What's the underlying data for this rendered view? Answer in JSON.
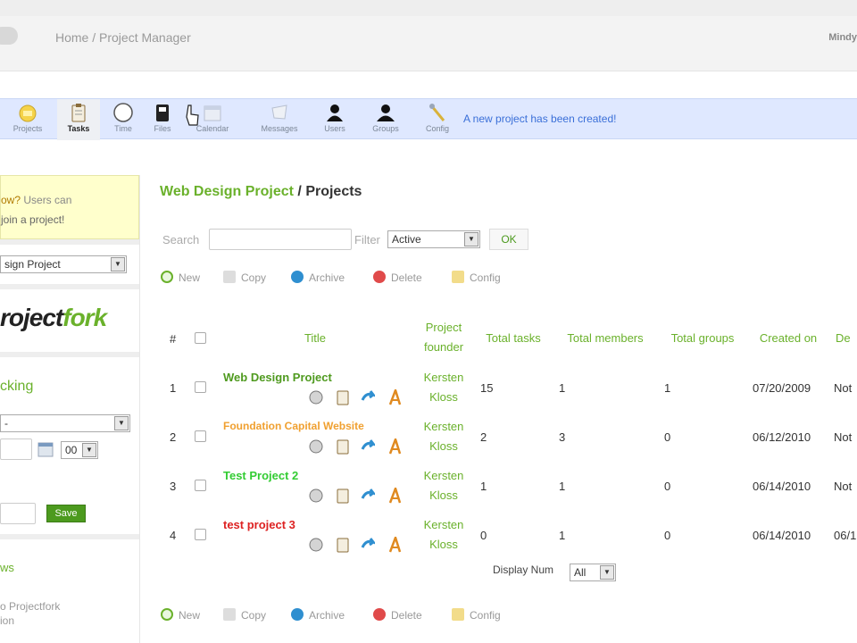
{
  "header": {
    "breadcrumb": "Home / Project Manager",
    "user": "Mindy"
  },
  "toolbar": {
    "items": [
      {
        "label": "Projects",
        "icon": "projects-icon"
      },
      {
        "label": "Tasks",
        "icon": "clipboard-icon"
      },
      {
        "label": "Time",
        "icon": "clock-icon"
      },
      {
        "label": "Files",
        "icon": "file-icon"
      },
      {
        "label": "Calendar",
        "icon": "calendar-icon"
      },
      {
        "label": "Messages",
        "icon": "messages-icon"
      },
      {
        "label": "Users",
        "icon": "user-icon"
      },
      {
        "label": "Groups",
        "icon": "group-icon"
      },
      {
        "label": "Config",
        "icon": "wrench-icon"
      }
    ],
    "status_message": "A new project has been created!"
  },
  "sidebar": {
    "notice_q": "ow?",
    "notice_rest": " Users can",
    "notice_line2": "join a project!",
    "project_select": "sign Project",
    "logo_part1": "roject",
    "logo_part2": "fork",
    "tracking": "cking",
    "tracking_select": "-",
    "minutes_value": "00",
    "save_label": "Save",
    "news_heading": "ws",
    "news_item1": "o Projectfork",
    "news_item2": "ion"
  },
  "main": {
    "project_link": "Web Design Project",
    "separator": " / ",
    "page": "Projects",
    "search_label": "Search",
    "filter_label": "Filter",
    "filter_value": "Active",
    "ok_label": "OK",
    "actions": [
      "New",
      "Copy",
      "Archive",
      "Delete",
      "Config"
    ],
    "display_num_label": "Display Num",
    "display_num_value": "All"
  },
  "table": {
    "headers": {
      "num": "#",
      "title": "Title",
      "founder_line1": "Project",
      "founder_line2": "founder",
      "total_tasks": "Total tasks",
      "total_members": "Total members",
      "total_groups": "Total groups",
      "created_on": "Created on",
      "deadline": "De"
    },
    "rows": [
      {
        "num": "1",
        "title": "Web Design Project",
        "title_color": "#4f9a1f",
        "founder_first": "Kersten",
        "founder_last": "Kloss",
        "tasks": "15",
        "members": "1",
        "groups": "1",
        "created": "07/20/2009",
        "deadline": "Not"
      },
      {
        "num": "2",
        "title": "Foundation Capital Website",
        "title_color": "#f0a030",
        "founder_first": "Kersten",
        "founder_last": "Kloss",
        "tasks": "2",
        "members": "3",
        "groups": "0",
        "created": "06/12/2010",
        "deadline": "Not"
      },
      {
        "num": "3",
        "title": "Test Project 2",
        "title_color": "#33cc33",
        "founder_first": "Kersten",
        "founder_last": "Kloss",
        "tasks": "1",
        "members": "1",
        "groups": "0",
        "created": "06/14/2010",
        "deadline": "Not"
      },
      {
        "num": "4",
        "title": "test project 3",
        "title_color": "#dd2222",
        "founder_first": "Kersten",
        "founder_last": "Kloss",
        "tasks": "0",
        "members": "1",
        "groups": "0",
        "created": "06/14/2010",
        "deadline": "06/1"
      }
    ]
  },
  "colors": {
    "accent_green": "#6ab12b",
    "toolbar_bg": "#dfe8ff",
    "status_blue": "#3a6fd8"
  }
}
